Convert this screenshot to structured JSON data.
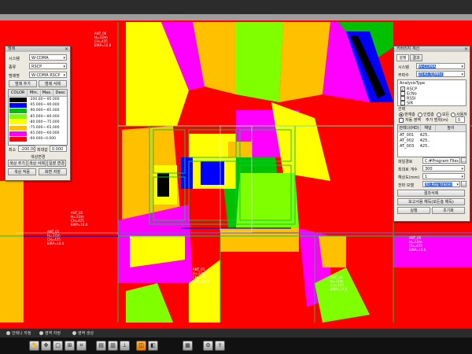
{
  "legend_panel": {
    "title": "범례",
    "system_label": "시스템",
    "system_value": "W-CDMA",
    "type_label": "종류",
    "type_value": "RSCP",
    "range_label": "범례명",
    "range_value": "W-CDMA RSCP",
    "add_range_button": "범례 추가",
    "delete_range_button": "범례 삭제",
    "columns": [
      "COLOR",
      "Min.",
      "Max.",
      "Desc"
    ],
    "rows": [
      {
        "color": "#000000",
        "label": "-200.00~-95.000"
      },
      {
        "color": "#0000ff",
        "label": "-95.000~-90.000"
      },
      {
        "color": "#00c000",
        "label": "-90.000~-85.000"
      },
      {
        "color": "#7fff00",
        "label": "-85.000~-80.000"
      },
      {
        "color": "#ffff00",
        "label": "-80.000~-75.000"
      },
      {
        "color": "#ffc000",
        "label": "-75.000~-65.000"
      },
      {
        "color": "#ff00ff",
        "label": "-65.000~-60.000"
      },
      {
        "color": "#ff0000",
        "label": "-60.000~0.000"
      }
    ],
    "min_label": "최소",
    "min_value": "-200.000",
    "max_label": "최대값",
    "max_value": "0.000",
    "color_change_label": "색상변경",
    "color_add_button": "색상 추가",
    "color_delete_button": "색상 삭제",
    "apply_all_button": "일괄 변경",
    "apply_color_button": "색상 적용",
    "save_button": "화면 저장"
  },
  "analysis_panel": {
    "title": "커버리지 계산",
    "tab_settings": "설정",
    "tab_results": "결과",
    "system_label": "시스템",
    "system_value": "W-CDMA",
    "frequency_label": "주파수",
    "frequency_value": "2142.5[MHz]",
    "analysis_type_header": "AnalysisType",
    "analysis_types": [
      {
        "label": "RSCP",
        "checked": true
      },
      {
        "label": "EcNo",
        "checked": true
      },
      {
        "label": "RSSI",
        "checked": true
      },
      {
        "label": "SIR",
        "checked": true
      }
    ],
    "selection_label": "선택",
    "scope_options": [
      {
        "label": "현재층",
        "selected": true
      },
      {
        "label": "인접층",
        "selected": false
      },
      {
        "label": "모든",
        "selected": false
      },
      {
        "label": "사용자",
        "selected": false
      }
    ],
    "auto_range_label": "자동 영역",
    "add_range_label": "추가 범위(m)",
    "add_range_value": "0",
    "antenna_columns": [
      "안테나(HD)",
      "채널",
      "높이"
    ],
    "antennas": [
      {
        "name": "AT_001",
        "channel": "425.."
      },
      {
        "name": "AT_002",
        "channel": "425.."
      },
      {
        "name": "AT_003",
        "channel": "425.."
      }
    ],
    "file_path_label": "파일경로",
    "file_path_value": "C:#Program Files (x86)#KT_1",
    "max_rays_label": "최대로 개수",
    "max_rays_value": "300",
    "resolution_label": "해상도(mm)",
    "resolution_value": "1",
    "propagation_model_label": "전파 모델",
    "propagation_model_value": "3D Ray tracer",
    "result_delete_button": "결과삭제",
    "report_button": "보고서용 해득(모든층 해득)",
    "run_button": "실행",
    "reset_button": "초기화"
  },
  "status_bar": {
    "items": [
      "안테나 자정",
      "영역 자정",
      "영역 생성"
    ]
  },
  "toolbar": {
    "buttons": [
      "hand-icon",
      "pan-icon",
      "select-icon",
      "measure-icon",
      "grid-icon",
      "layer-icon",
      "floor-icon",
      "antenna-icon",
      "route-icon",
      "coverage-icon",
      "report-icon",
      "settings-icon",
      "export-icon"
    ]
  },
  "map": {
    "antenna_labels": [
      "ANT_01\nH=3.0m\nCH=425\nEIRP=10.0",
      "ANT_02\nH=3.0m\nCH=425\nEIRP=10.0",
      "ANT_03\nH=3.0m\nCH=425\nEIRP=10.0",
      "ANT_04\nH=3.0m\nCH=425\nEIRP=10.0",
      "ANT_05\nH=3.0m\nCH=425\nEIRP=10.0",
      "ANT_06\nH=3.0m\nCH=425\nEIRP=10.0"
    ]
  }
}
